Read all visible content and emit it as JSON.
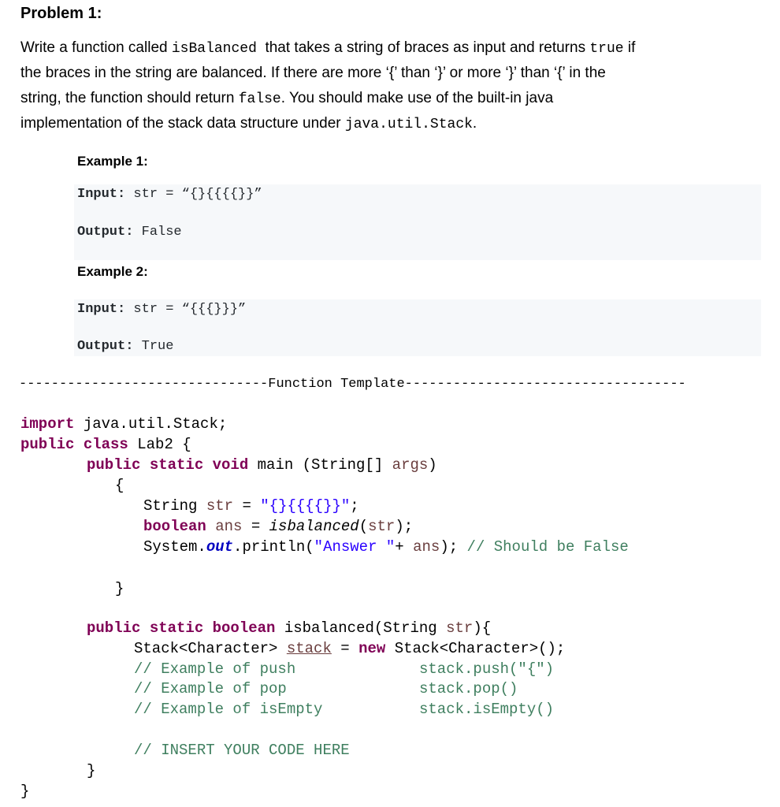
{
  "title": "Problem 1:",
  "description": {
    "line1_pre": "Write a function called ",
    "line1_code": "isBalanced",
    "line1_mid": "  that takes a string of braces as input and returns ",
    "line1_code2": "true",
    "line1_post": " if",
    "line2": "the braces in the string are balanced. If there are more ‘{’ than ‘}’ or more ‘}’ than ‘{’ in the",
    "line3_pre": "string, the function should return ",
    "line3_code": "false",
    "line3_post": ". You should make use of the built-in java",
    "line4_pre": "implementation of the stack data structure under ",
    "line4_code": "java.util.Stack",
    "line4_post": "."
  },
  "examples": [
    {
      "label": "Example 1:",
      "input_key": "Input:",
      "input_val": " str = “{}{{{{}}”",
      "output_key": "Output:",
      "output_val": " False"
    },
    {
      "label": "Example 2:",
      "input_key": "Input:",
      "input_val": " str = “{{{}}}”",
      "output_key": "Output:",
      "output_val": " True"
    }
  ],
  "divider": "-------------------------------Function Template-----------------------------------",
  "code": {
    "l1_kw": "import",
    "l1_rest": " java.util.Stack;",
    "l2_kw1": "public",
    "l2_kw2": "class",
    "l2_rest": " Lab2 {",
    "l3_kw": "public static void",
    "l3_mid": " main (String[] ",
    "l3_var": "args",
    "l3_end": ")",
    "l4": "{",
    "l5_a": "String ",
    "l5_var": "str",
    "l5_b": " = ",
    "l5_str": "\"{}{{{{}}\"",
    "l5_c": ";",
    "l6_kw": "boolean",
    "l6_var": " ans",
    "l6_b": " = ",
    "l6_call": "isbalanced",
    "l6_c": "(",
    "l6_var2": "str",
    "l6_d": ");",
    "l7_a": "System.",
    "l7_field": "out",
    "l7_b": ".println(",
    "l7_str": "\"Answer \"",
    "l7_c": "+ ",
    "l7_var": "ans",
    "l7_d": "); ",
    "l7_cmt": "// Should be False",
    "l8": "}",
    "l9_kw": "public static boolean",
    "l9_mid": " isbalanced(String ",
    "l9_var": "str",
    "l9_end": "){",
    "l10_a": "Stack<Character> ",
    "l10_var": "stack",
    "l10_b": " = ",
    "l10_kw": "new",
    "l10_c": " Stack<Character>();",
    "comments": [
      {
        "left": "// Example of push",
        "right": "stack.push(\"{\")"
      },
      {
        "left": "// Example of pop",
        "right": "stack.pop()"
      },
      {
        "left": "// Example of isEmpty",
        "right": "stack.isEmpty()"
      }
    ],
    "insert": "// INSERT YOUR CODE HERE",
    "close_method": "}",
    "close_class": "}"
  }
}
